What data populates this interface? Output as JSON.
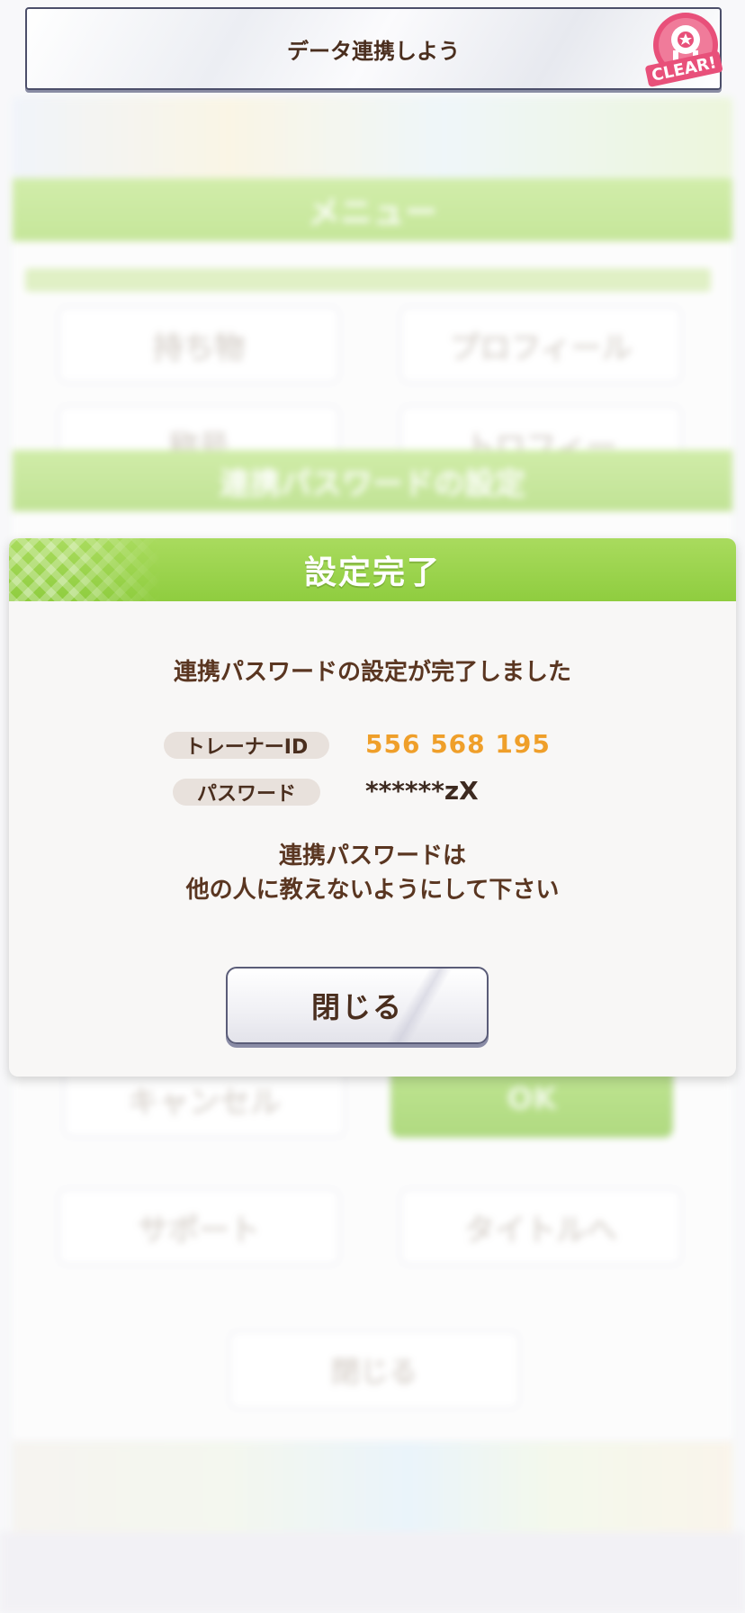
{
  "mission": {
    "text": "データ連携しよう",
    "badge": "CLEAR!"
  },
  "background": {
    "menu_title": "メニュー",
    "buttons": [
      "持ち物",
      "プロフィール",
      "称号",
      "トロフィー",
      "キャンセル",
      "OK",
      "サポート",
      "タイトルへ"
    ],
    "password_setting_title": "連携パスワードの設定",
    "close_label": "閉じる"
  },
  "modal": {
    "title": "設定完了",
    "message": "連携パスワードの設定が完了しました",
    "trainer_id_label": "トレーナーID",
    "trainer_id_value": "556 568 195",
    "password_label": "パスワード",
    "password_value": "******zX",
    "warning_line1": "連携パスワードは",
    "warning_line2": "他の人に教えないようにして下さい",
    "close_button": "閉じる"
  },
  "colors": {
    "header_green": "#8fcd3f",
    "id_orange": "#ef9f2a",
    "text_brown": "#5a3621",
    "badge_pink": "#e8507a"
  }
}
